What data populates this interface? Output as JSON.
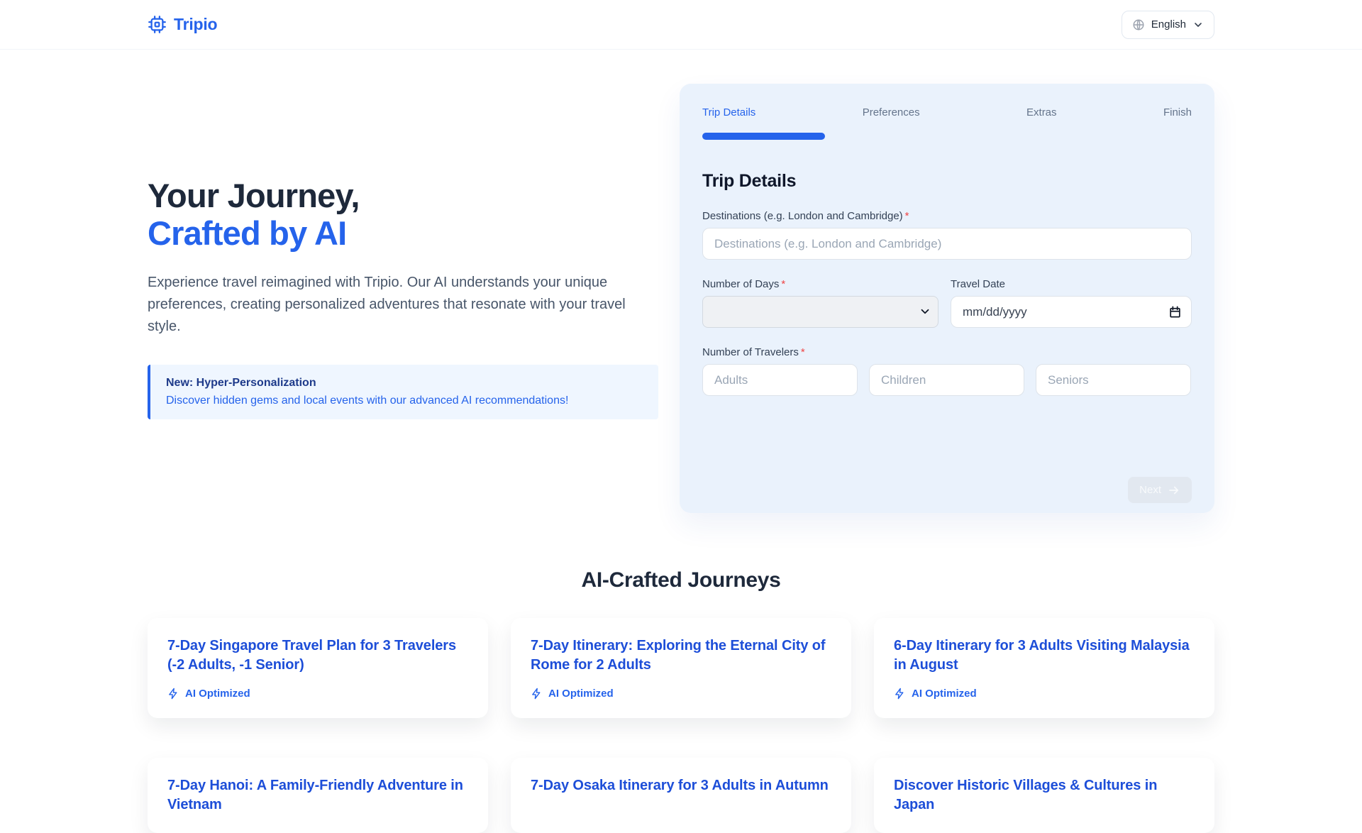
{
  "header": {
    "brand": "Tripio",
    "language_button": {
      "label": "English"
    }
  },
  "hero": {
    "title_line1": "Your Journey,",
    "title_line2": "Crafted by AI",
    "description": "Experience travel reimagined with Tripio. Our AI understands your unique preferences, creating personalized adventures that resonate with your travel style.",
    "callout": {
      "title": "New: Hyper-Personalization",
      "description": "Discover hidden gems and local events with our advanced AI recommendations!"
    }
  },
  "wizard": {
    "steps": [
      {
        "label": "Trip Details",
        "active": true
      },
      {
        "label": "Preferences",
        "active": false
      },
      {
        "label": "Extras",
        "active": false
      },
      {
        "label": "Finish",
        "active": false
      }
    ],
    "progress_percent": 25,
    "heading": "Trip Details",
    "required_mark": "*",
    "destinations": {
      "label": "Destinations (e.g. London and Cambridge)",
      "placeholder": "Destinations (e.g. London and Cambridge)",
      "value": ""
    },
    "days": {
      "label": "Number of Days",
      "value": ""
    },
    "travel_date": {
      "label": "Travel Date",
      "placeholder": "mm/dd/yyyy",
      "value": ""
    },
    "travelers": {
      "label": "Number of Travelers",
      "adults_placeholder": "Adults",
      "children_placeholder": "Children",
      "seniors_placeholder": "Seniors"
    },
    "next_button": {
      "label": "Next",
      "enabled": false
    }
  },
  "journeys": {
    "heading": "AI-Crafted Journeys",
    "badge": "AI Optimized",
    "cards": [
      {
        "title": "7-Day Singapore Travel Plan for 3 Travelers (-2 Adults, -1 Senior)"
      },
      {
        "title": "7-Day Itinerary: Exploring the Eternal City of Rome for 2 Adults"
      },
      {
        "title": "6-Day Itinerary for 3 Adults Visiting Malaysia in August"
      }
    ],
    "partial_cards": [
      {
        "title": "7-Day Hanoi: A Family-Friendly Adventure in Vietnam"
      },
      {
        "title": "7-Day Osaka Itinerary for 3 Adults in Autumn"
      },
      {
        "title": "Discover Historic Villages & Cultures in Japan"
      }
    ]
  },
  "colors": {
    "primary": "#2563eb",
    "card_title_blue": "#1d4ed8",
    "heading_dark": "#1e293b",
    "callout_bg": "#eff6ff",
    "callout_title": "#1e40af",
    "wizard_card_bg": "#eaf2fc",
    "disabled_button_bg": "#e2e8f0",
    "required_red": "#ef4444"
  }
}
